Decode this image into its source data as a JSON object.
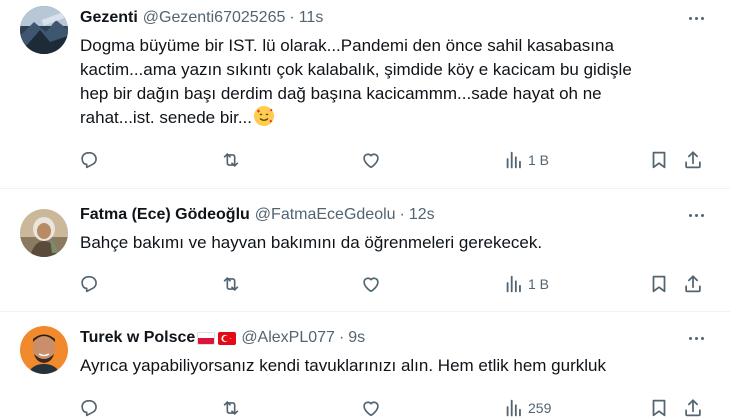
{
  "tweets": [
    {
      "name": "Gezenti",
      "handle": "@Gezenti67025265",
      "separator": "·",
      "time": "11s",
      "avatar": "landscape-avatar",
      "lines": [
        "Dogma büyüme bir IST. lü olarak...Pandemi den önce  sahil kasabasına",
        "kactim...ama yazın sıkıntı çok kalabalık,  şimdide köy e kacicam bu gidişle",
        "hep bir dağın başı derdim dağ başına kacicammm...sade hayat oh ne",
        "rahat...ist. senede bir..."
      ],
      "emoji": "smiling-face-with-hearts",
      "views": "1 B"
    },
    {
      "name": "Fatma (Ece) Gödeoğlu",
      "handle": "@FatmaEceGdeolu",
      "separator": "·",
      "time": "12s",
      "avatar": "person-with-headscarf-avatar",
      "lines": [
        "Bahçe bakımı ve hayvan bakımını da öğrenmeleri gerekecek."
      ],
      "views": "1 B"
    },
    {
      "name": "Turek w Polsce",
      "flags": [
        "poland-flag",
        "turkey-flag"
      ],
      "handle": "@AlexPL077",
      "separator": "·",
      "time": "9s",
      "avatar": "smiling-man-avatar",
      "lines": [
        "Ayrıca yapabiliyorsanız kendi tavuklarınızı alın. Hem etlik hem gurkluk"
      ],
      "views": "259"
    }
  ],
  "icons": {
    "reply": "reply-icon",
    "retweet": "retweet-icon",
    "like": "like-icon",
    "views": "views-icon",
    "bookmark": "bookmark-icon",
    "share": "share-icon",
    "more": "more-icon"
  },
  "colors": {
    "text": "#0f1419",
    "secondary": "#536471",
    "divider": "#eff3f4"
  }
}
